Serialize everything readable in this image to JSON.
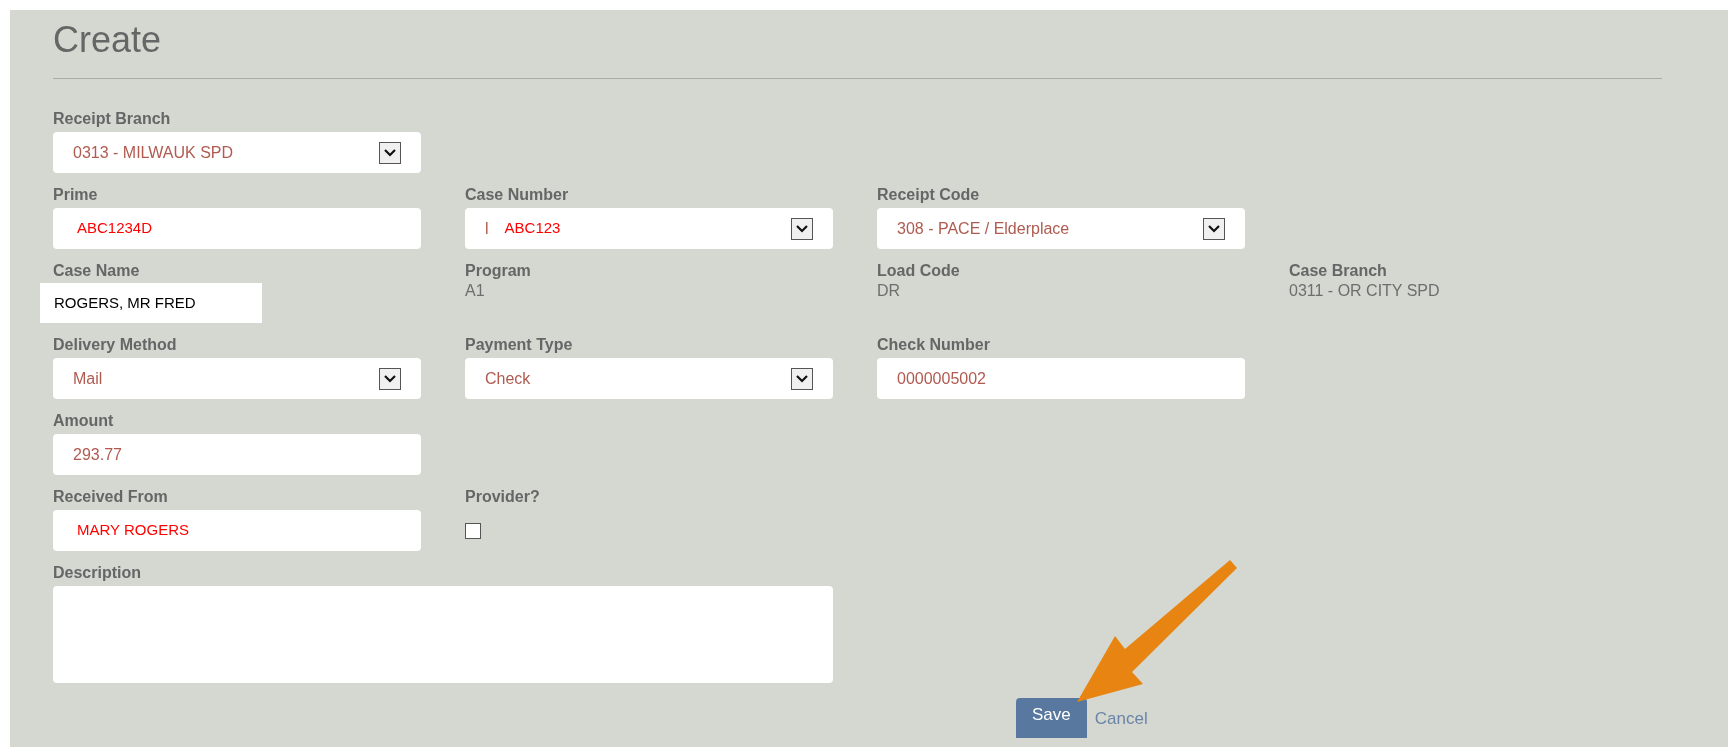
{
  "title": "Create",
  "rows": [
    [
      {
        "kind": "select",
        "label": "Receipt Branch",
        "value": "0313 - MILWAUK SPD",
        "patched": false
      }
    ],
    [
      {
        "kind": "input",
        "label": "Prime",
        "value": "ABC1234D",
        "patched": true
      },
      {
        "kind": "select",
        "label": "Case Number",
        "value": "ABC123",
        "cut_text": "l",
        "patched": true
      },
      {
        "kind": "select",
        "label": "Receipt Code",
        "value": "308 - PACE / Elderplace",
        "patched": false
      }
    ],
    [
      {
        "kind": "static",
        "label": "Case Name",
        "value": "ROGERS, MR FRED",
        "patched": true
      },
      {
        "kind": "static",
        "label": "Program",
        "value": "A1",
        "patched": false
      },
      {
        "kind": "static",
        "label": "Load Code",
        "value": "DR",
        "patched": false
      },
      {
        "kind": "static",
        "label": "Case Branch",
        "value": "0311 - OR CITY SPD",
        "patched": false
      }
    ],
    [
      {
        "kind": "select",
        "label": "Delivery Method",
        "value": "Mail",
        "patched": false
      },
      {
        "kind": "select",
        "label": "Payment Type",
        "value": "Check",
        "patched": false
      },
      {
        "kind": "input",
        "label": "Check Number",
        "value": "0000005002",
        "patched": false
      }
    ],
    [
      {
        "kind": "input",
        "label": "Amount",
        "value": "293.77",
        "patched": false
      }
    ],
    [
      {
        "kind": "input",
        "label": "Received From",
        "value": "MARY ROGERS",
        "patched": true
      },
      {
        "kind": "checkbox",
        "label": "Provider?",
        "checked": false
      }
    ],
    [
      {
        "kind": "textarea",
        "label": "Description"
      }
    ]
  ],
  "buttons": [
    {
      "kind": "primary",
      "label": "Save"
    },
    {
      "kind": "link",
      "label": "Cancel"
    }
  ]
}
